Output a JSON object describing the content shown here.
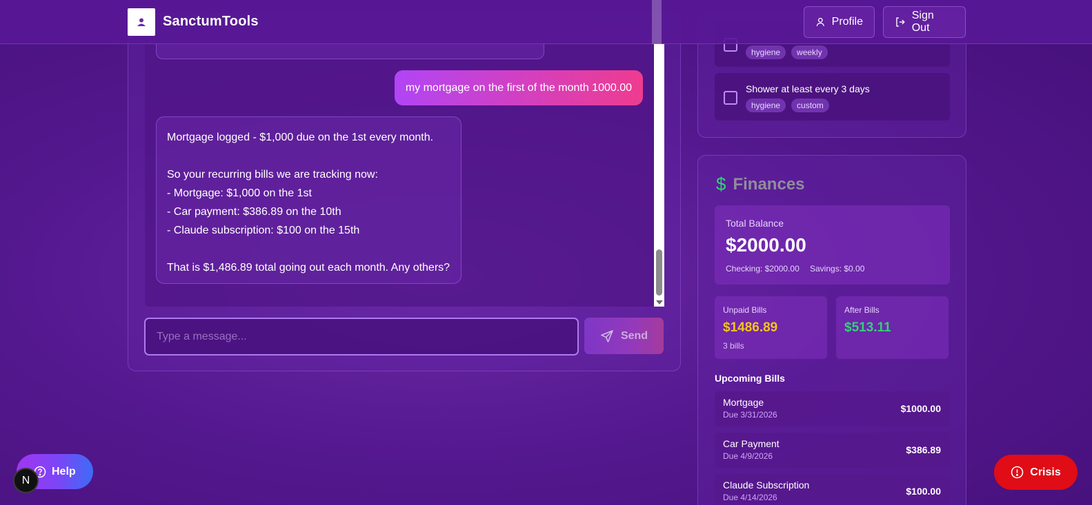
{
  "header": {
    "brand": "SanctumTools",
    "profile_label": "Profile",
    "signout_label": "Sign Out"
  },
  "chat": {
    "user_message": "my mortgage on the first of the month 1000.00",
    "assistant_lines": [
      "Mortgage logged - $1,000 due on the 1st every month.",
      "",
      "So your recurring bills we are tracking now:",
      "- Mortgage: $1,000 on the 1st",
      "- Car payment: $386.89 on the 10th",
      "- Claude subscription: $100 on the 15th",
      "",
      "That is $1,486.89 total going out each month. Any others?"
    ],
    "input_placeholder": "Type a message...",
    "send_label": "Send"
  },
  "tasks": [
    {
      "title": "",
      "tags": [
        "hygiene",
        "weekly"
      ]
    },
    {
      "title": "Shower at least every 3 days",
      "tags": [
        "hygiene",
        "custom"
      ]
    }
  ],
  "finances": {
    "title": "Finances",
    "icon": "dollar-icon",
    "total_balance_label": "Total Balance",
    "total_balance": "$2000.00",
    "checking": "Checking: $2000.00",
    "savings": "Savings: $0.00",
    "unpaid_label": "Unpaid Bills",
    "unpaid_value": "$1486.89",
    "unpaid_count": "3 bills",
    "after_label": "After Bills",
    "after_value": "$513.11",
    "upcoming_title": "Upcoming Bills",
    "bills": [
      {
        "name": "Mortgage",
        "due": "Due 3/31/2026",
        "amount": "$1000.00"
      },
      {
        "name": "Car Payment",
        "due": "Due 4/9/2026",
        "amount": "$386.89"
      },
      {
        "name": "Claude Subscription",
        "due": "Due 4/14/2026",
        "amount": "$100.00"
      }
    ]
  },
  "floating": {
    "help_label": "Help",
    "n_badge": "N",
    "crisis_label": "Crisis"
  },
  "colors": {
    "accent_purple": "#6b2aa6",
    "unpaid_yellow": "#f5c518",
    "after_green": "#33d17a",
    "crisis_red": "#e00c16"
  }
}
